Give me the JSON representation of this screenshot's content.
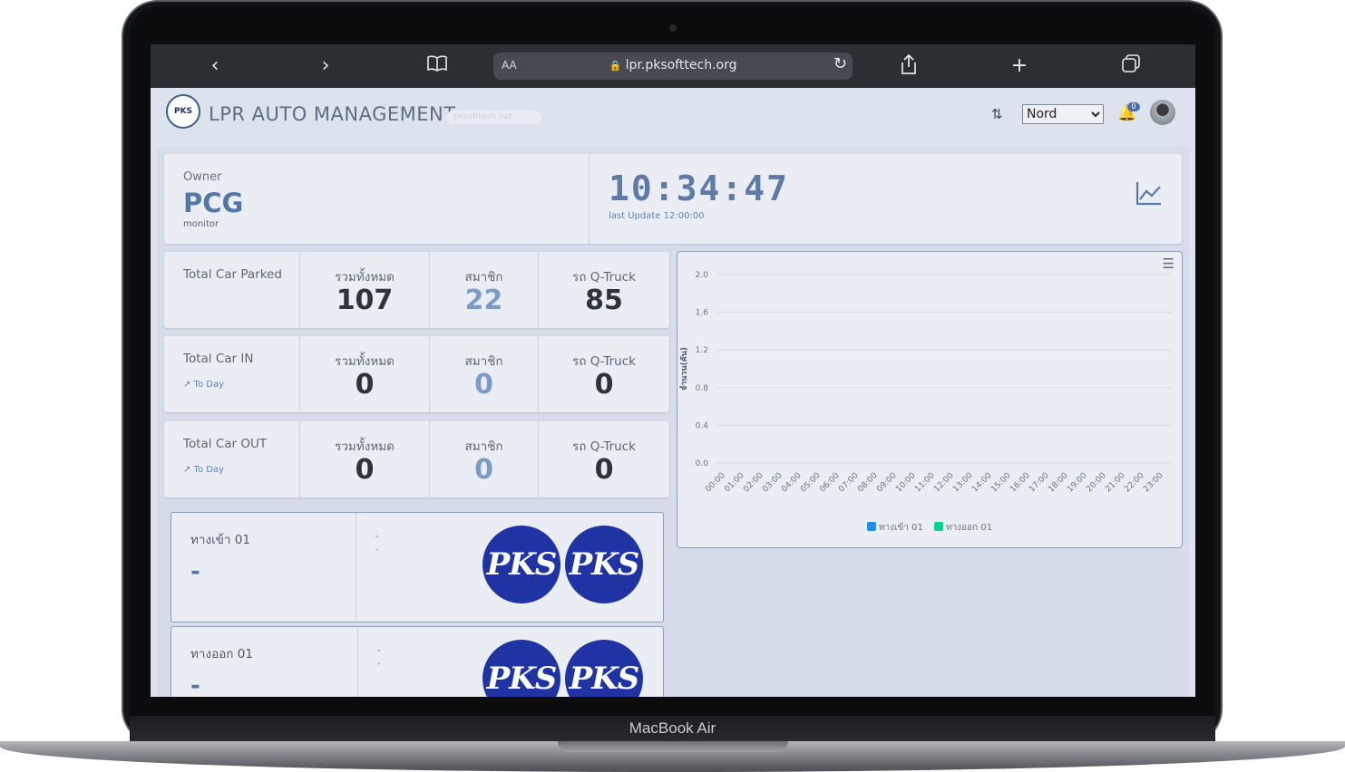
{
  "device": {
    "label": "MacBook Air"
  },
  "browser": {
    "url": "lpr.pksofttech.org",
    "text_size_label": "AA"
  },
  "app": {
    "logo_text": "PKS",
    "title": "LPR AUTO MANAGEMENT",
    "subtitle_pill": "pksofttech.net",
    "theme_select": {
      "selected": "Nord"
    },
    "notifications": {
      "count": "0"
    }
  },
  "owner": {
    "label": "Owner",
    "value": "PCG",
    "role": "monitor"
  },
  "clock": {
    "time": "10:34:47",
    "last_update": "last Update 12:00:00"
  },
  "stats": {
    "col_total": "รวมทั้งหมด",
    "col_member": "สมาชิก",
    "col_qtruck": "รถ Q-Truck",
    "rows": [
      {
        "title": "Total Car Parked",
        "link": "",
        "total": "107",
        "member": "22",
        "qtruck": "85"
      },
      {
        "title": "Total Car IN",
        "link": "↗ To Day",
        "total": "0",
        "member": "0",
        "qtruck": "0"
      },
      {
        "title": "Total Car OUT",
        "link": "↗ To Day",
        "total": "0",
        "member": "0",
        "qtruck": "0"
      }
    ]
  },
  "gates": [
    {
      "name": "ทางเข้า 01",
      "plate": "-",
      "line1": "-",
      "line2": "-",
      "image_a": "PKS",
      "image_b": "PKS"
    },
    {
      "name": "ทางออก 01",
      "plate": "-",
      "line1": "-",
      "line2": "-",
      "image_a": "PKS",
      "image_b": "PKS"
    }
  ],
  "chart_data": {
    "type": "bar",
    "title": "",
    "xlabel": "",
    "ylabel": "จำนวน(คัน)",
    "ylim": [
      0,
      2.0
    ],
    "yticks": [
      "0.0",
      "0.4",
      "0.8",
      "1.2",
      "1.6",
      "2.0"
    ],
    "categories": [
      "00:00",
      "01:00",
      "02:00",
      "03:00",
      "04:00",
      "05:00",
      "06:00",
      "07:00",
      "08:00",
      "09:00",
      "10:00",
      "11:00",
      "12:00",
      "13:00",
      "14:00",
      "15:00",
      "16:00",
      "17:00",
      "18:00",
      "19:00",
      "20:00",
      "21:00",
      "22:00",
      "23:00"
    ],
    "series": [
      {
        "name": "ทางเข้า 01",
        "color": "#1f8ef1",
        "values": [
          0,
          0,
          0,
          0,
          0,
          0,
          0,
          0,
          0,
          0,
          0,
          0,
          0,
          0,
          0,
          0,
          0,
          0,
          0,
          0,
          0,
          0,
          0,
          0
        ]
      },
      {
        "name": "ทางออก 01",
        "color": "#00d68f",
        "values": [
          0,
          0,
          0,
          0,
          0,
          0,
          0,
          0,
          0,
          0,
          0,
          0,
          0,
          0,
          0,
          0,
          0,
          0,
          0,
          0,
          0,
          0,
          0,
          0
        ]
      }
    ],
    "grid": true,
    "legend": "bottom"
  }
}
